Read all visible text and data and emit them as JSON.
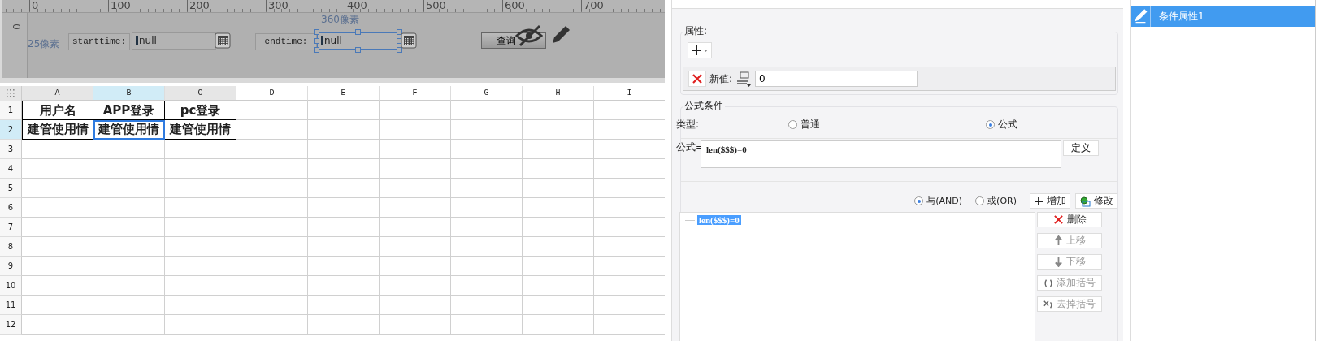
{
  "ruler": {
    "ticks": [
      "0",
      "100",
      "200",
      "300",
      "400",
      "500",
      "600",
      "700"
    ],
    "side_tick": "0"
  },
  "canvas": {
    "width_label": "360像素",
    "height_label": "25像素",
    "params": [
      {
        "label": "starttime:",
        "value": "null",
        "selected": false
      },
      {
        "label": "endtime:",
        "value": "null",
        "selected": true
      }
    ],
    "query_button": "查询"
  },
  "sheet": {
    "columns": [
      {
        "label": "A",
        "selected": false
      },
      {
        "label": "B",
        "selected": true
      },
      {
        "label": "C",
        "selected": false
      },
      {
        "label": "D",
        "selected": false
      },
      {
        "label": "E",
        "selected": false
      },
      {
        "label": "F",
        "selected": false
      },
      {
        "label": "G",
        "selected": false
      },
      {
        "label": "H",
        "selected": false
      },
      {
        "label": "I",
        "selected": false
      }
    ],
    "rows": [
      {
        "number": "1",
        "selected": false,
        "cells": [
          {
            "text": "用户名",
            "selected": false
          },
          {
            "text": "APP登录",
            "selected": false
          },
          {
            "text": "pc登录",
            "selected": false
          }
        ]
      },
      {
        "number": "2",
        "selected": true,
        "cells": [
          {
            "text": "建管使用情",
            "selected": false
          },
          {
            "text": "建管使用情",
            "selected": true
          },
          {
            "text": "建管使用情",
            "selected": false
          }
        ]
      },
      {
        "number": "3",
        "selected": false
      },
      {
        "number": "4",
        "selected": false
      },
      {
        "number": "5",
        "selected": false
      },
      {
        "number": "6",
        "selected": false
      },
      {
        "number": "7",
        "selected": false
      },
      {
        "number": "8",
        "selected": false
      },
      {
        "number": "9",
        "selected": false
      },
      {
        "number": "10",
        "selected": false
      },
      {
        "number": "11",
        "selected": false
      },
      {
        "number": "12",
        "selected": false
      }
    ]
  },
  "properties": {
    "title": "属性:",
    "new_value_label": "新值:",
    "new_value": "0"
  },
  "formula_condition": {
    "title": "公式条件",
    "type_label": "类型:",
    "types": [
      {
        "label": "普通",
        "selected": false
      },
      {
        "label": "公式",
        "selected": true
      }
    ],
    "formula_label": "公式=",
    "formula": "len($$$)=0",
    "define_button": "定义",
    "logic": [
      {
        "label": "与(AND)",
        "selected": true
      },
      {
        "label": "或(OR)",
        "selected": false
      }
    ],
    "add_button": "增加",
    "modify_button": "修改",
    "conditions": [
      {
        "text": "len($$$)=0",
        "selected": true
      }
    ],
    "actions": [
      {
        "kind": "delete",
        "label": "删除",
        "disabled": false
      },
      {
        "kind": "up",
        "label": "上移",
        "disabled": true
      },
      {
        "kind": "down",
        "label": "下移",
        "disabled": true
      },
      {
        "kind": "add-bracket",
        "label": "添加括号",
        "disabled": true
      },
      {
        "kind": "remove-bracket",
        "label": "去掉括号",
        "disabled": true
      }
    ]
  },
  "condition_list": {
    "items": [
      {
        "label": "条件属性1",
        "selected": true
      }
    ]
  }
}
